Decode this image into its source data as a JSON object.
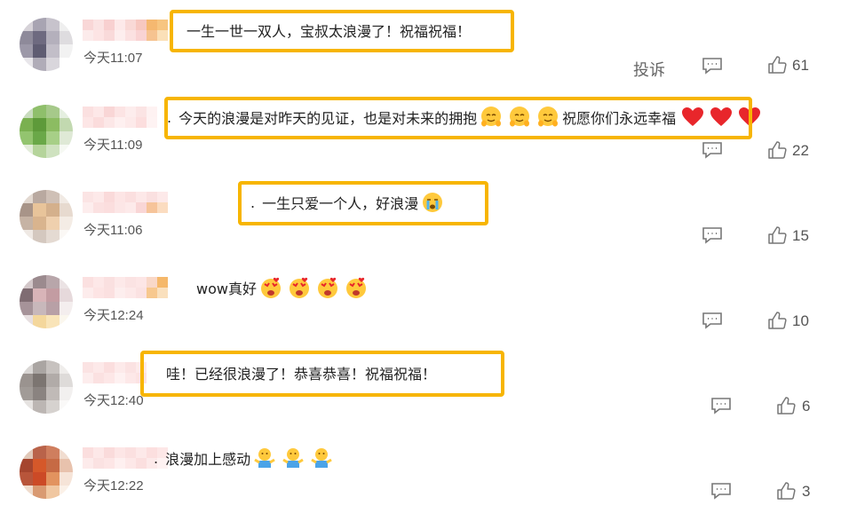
{
  "comments": [
    {
      "time": "今天11:07",
      "text": "一生一世一双人，宝叔太浪漫了！祝福祝福！",
      "likes": "61",
      "report_label": "投诉",
      "avatar_colors": [
        "#d6d2d8",
        "#a8a4b2",
        "#c7c3cc",
        "#efefef",
        "#8e8a9a",
        "#6e6a80",
        "#b4b0bc",
        "#dedcdf",
        "#9c98a8",
        "#5f5c72",
        "#c2bec8",
        "#f2f2f2",
        "#e8e6ea",
        "#b0acb8",
        "#d9d6dc",
        "#ffffff"
      ],
      "nick_colors": [
        "#f9d7d7",
        "#fbe3e3",
        "#f8d0d0",
        "#fde9e9",
        "#f9d9d6",
        "#f7c8c0",
        "#f5b870",
        "#f7c580",
        "#fcebeb",
        "#fde4e4",
        "#f9dada",
        "#fdeeee",
        "#fbe1e1",
        "#f9d3d3",
        "#f6c390",
        "#fbe0b8"
      ]
    },
    {
      "time": "今天11:09",
      "text_lead": ".",
      "text": "今天的浪漫是对昨天的见证，也是对未来的拥抱",
      "text_tail": "祝愿你们永远幸福",
      "likes": "22",
      "avatar_colors": [
        "#c9dcbe",
        "#8fbf6b",
        "#a6c98a",
        "#e5efe0",
        "#7ab050",
        "#5e9a3a",
        "#8cbc62",
        "#c2d9b0",
        "#93c46f",
        "#6aa848",
        "#a7cf87",
        "#dfe9d6",
        "#e3ecda",
        "#b5d49b",
        "#cfe2c0",
        "#f6f9f3"
      ],
      "nick_colors": [
        "#fbe0e0",
        "#fde8e8",
        "#f9d6d6",
        "#fce4e4",
        "#fdeded",
        "#fbe4e4",
        "#fef2f2",
        "#ffffff",
        "#fde6e6",
        "#fbdcdc",
        "#fce7e7",
        "#fef0f0",
        "#fdeaea",
        "#fcdede",
        "#fef3f3",
        "#ffffff"
      ]
    },
    {
      "time": "今天11:06",
      "text_lead": ".",
      "text": "一生只爱一个人，好浪漫",
      "likes": "15",
      "avatar_colors": [
        "#e2d8d0",
        "#b9a9a0",
        "#cfc0b6",
        "#f1eae4",
        "#a89488",
        "#e8c49a",
        "#d4b08c",
        "#e7dacf",
        "#c6b3a4",
        "#d9b48e",
        "#efd0ae",
        "#f4ece5",
        "#efe9e4",
        "#d4c8bf",
        "#e4dad2",
        "#fbf8f5"
      ],
      "nick_colors": [
        "#fbe4e4",
        "#fde9e9",
        "#fadada",
        "#fde5e5",
        "#fbdfdf",
        "#fde8e8",
        "#fae0e0",
        "#fde9e9",
        "#fdeded",
        "#fbe1e1",
        "#fbdede",
        "#fce6e6",
        "#fdeaea",
        "#f9d6d6",
        "#f6c49a",
        "#fbdcc0"
      ]
    },
    {
      "time": "今天12:24",
      "text": "wow真好",
      "likes": "10",
      "avatar_colors": [
        "#d3c7c9",
        "#9b8a8e",
        "#b8a6aa",
        "#ebe3e4",
        "#7f6c72",
        "#d8b4b8",
        "#c39ca2",
        "#e6d9db",
        "#a69399",
        "#c8b8bb",
        "#b8a0a6",
        "#f4eeee",
        "#e7dfe0",
        "#f4d79c",
        "#f9e4b8",
        "#fbf7ee"
      ],
      "nick_colors": [
        "#fbe0e0",
        "#fde8e8",
        "#fae0e0",
        "#fde9e9",
        "#fbe3e3",
        "#fde6e6",
        "#f9d8c8",
        "#f5b86a",
        "#fdecec",
        "#fde4e4",
        "#fbe0e0",
        "#fdeeee",
        "#fde9e9",
        "#fbe2e2",
        "#f7c88e",
        "#fae0bd"
      ]
    },
    {
      "time": "今天12:40",
      "text": "哇！已经很浪漫了！恭喜恭喜！祝福祝福！",
      "likes": "6",
      "avatar_colors": [
        "#d9d6d4",
        "#aaa5a2",
        "#c7c2bf",
        "#efedeb",
        "#9a938f",
        "#7c7571",
        "#b1aba8",
        "#deDbd9",
        "#a19b97",
        "#8a8380",
        "#c0bab7",
        "#f2f0ef",
        "#e6e3e1",
        "#bcb6b3",
        "#d6d2cf",
        "#faf9f8"
      ],
      "nick_colors": [
        "#fbe3e3",
        "#fde9e9",
        "#fbdede",
        "#fdeaea",
        "#fbe2e2",
        "#fdebeb",
        "#ffffff",
        "#ffffff",
        "#fdeded",
        "#fbe1e1",
        "#fde7e7",
        "#fef1f1",
        "#fde8e8",
        "#fce3e3",
        "#ffffff",
        "#ffffff"
      ]
    },
    {
      "time": "今天12:22",
      "text_lead": ".",
      "text": "浪漫加上感动",
      "likes": "3",
      "avatar_colors": [
        "#e1c8b8",
        "#b9634a",
        "#cf7e5e",
        "#f1ddd0",
        "#a5452e",
        "#d5582a",
        "#c66a44",
        "#e8c2ad",
        "#b8553a",
        "#cc4a26",
        "#e2935f",
        "#f6e4d8",
        "#efdccd",
        "#d99a72",
        "#f0c7a1",
        "#fbf1e8"
      ],
      "nick_colors": [
        "#fbdede",
        "#fde8e8",
        "#fadbdb",
        "#fde6e6",
        "#fbe0e0",
        "#fde9e9",
        "#fcdfdf",
        "#fde7e7",
        "#fdebeb",
        "#fbe2e2",
        "#fde6e6",
        "#fef0f0",
        "#fde8e8",
        "#fbdfdf",
        "#fdeaea",
        "#fef2f2"
      ]
    }
  ],
  "colors": {
    "highlight": "#f7b500",
    "heart": "#e8262b",
    "icon": "#777777"
  }
}
